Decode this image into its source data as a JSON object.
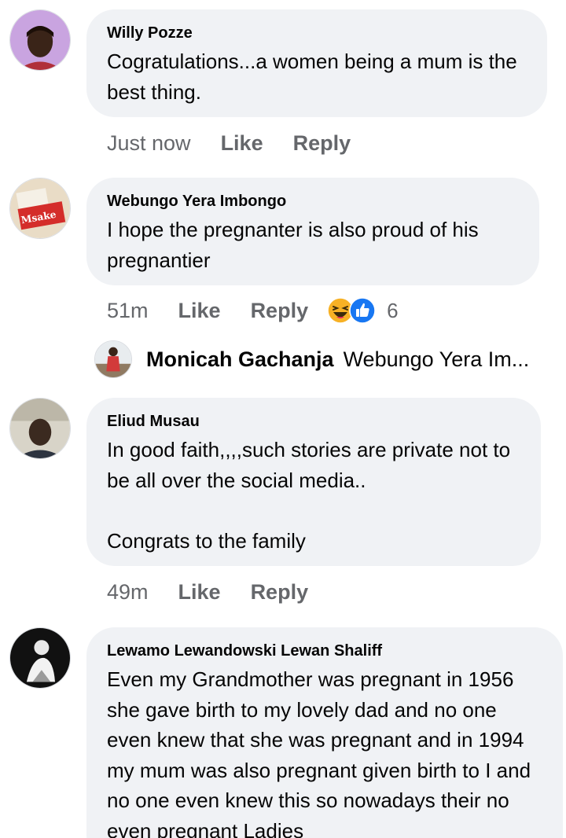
{
  "comments": [
    {
      "author": "Willy Pozze",
      "text": "Cogratulations...a women being a mum is the best thing.",
      "time": "Just now",
      "like": "Like",
      "reply": "Reply"
    },
    {
      "author": "Webungo Yera Imbongo",
      "text": "I hope the pregnanter is also proud of his pregnantier",
      "time": "51m",
      "like": "Like",
      "reply": "Reply",
      "avatar_text": "Msake",
      "reactions": [
        "haha-icon",
        "like-icon"
      ],
      "reaction_count": "6",
      "reply_preview": {
        "author": "Monicah Gachanja",
        "text": "Webungo Yera Im..."
      }
    },
    {
      "author": "Eliud Musau",
      "text": "In good faith,,,,such stories are private not to be all over the social media..\n\nCongrats to the family",
      "time": "49m",
      "like": "Like",
      "reply": "Reply"
    },
    {
      "author": "Lewamo Lewandowski Lewan Shaliff",
      "text": "Even my Grandmother was pregnant in 1956 she gave birth to my lovely dad and no one even knew that she was pregnant and in 1994 my mum was also pregnant given birth to I and no one even knew this so nowadays their no even pregnant Ladies"
    }
  ],
  "colors": {
    "bubble": "#f0f2f5",
    "meta": "#65676b",
    "text": "#050505",
    "like_blue": "#1877f2",
    "haha_yellow": "#f7b125"
  }
}
